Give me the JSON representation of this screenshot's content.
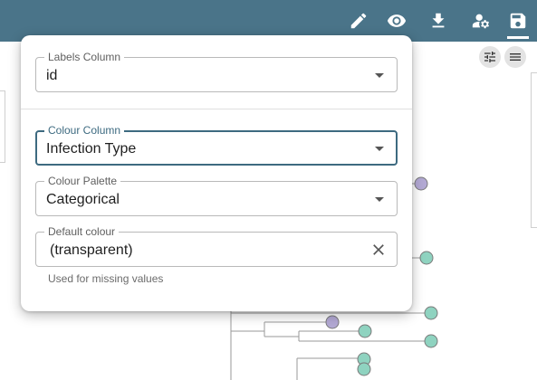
{
  "toolbar": {
    "buttons": [
      {
        "name": "edit",
        "icon": "pencil-icon"
      },
      {
        "name": "view",
        "icon": "eye-icon"
      },
      {
        "name": "download",
        "icon": "download-icon"
      },
      {
        "name": "user-settings",
        "icon": "user-gear-icon"
      },
      {
        "name": "save",
        "icon": "save-icon",
        "active": true
      }
    ]
  },
  "canvas_controls": {
    "icons": [
      "sliders-icon",
      "menu-icon"
    ]
  },
  "panel": {
    "labels_column": {
      "label": "Labels Column",
      "value": "id"
    },
    "colour_column": {
      "label": "Colour Column",
      "value": "Infection Type"
    },
    "colour_palette": {
      "label": "Colour Palette",
      "value": "Categorical"
    },
    "default_colour": {
      "label": "Default colour",
      "value": "(transparent)",
      "helper": "Used for missing values"
    }
  },
  "colors": {
    "topbar": "#4a7489",
    "focus": "#3d6a80",
    "node_teal": "#8fd3c0",
    "node_purple": "#b3a9d4"
  }
}
